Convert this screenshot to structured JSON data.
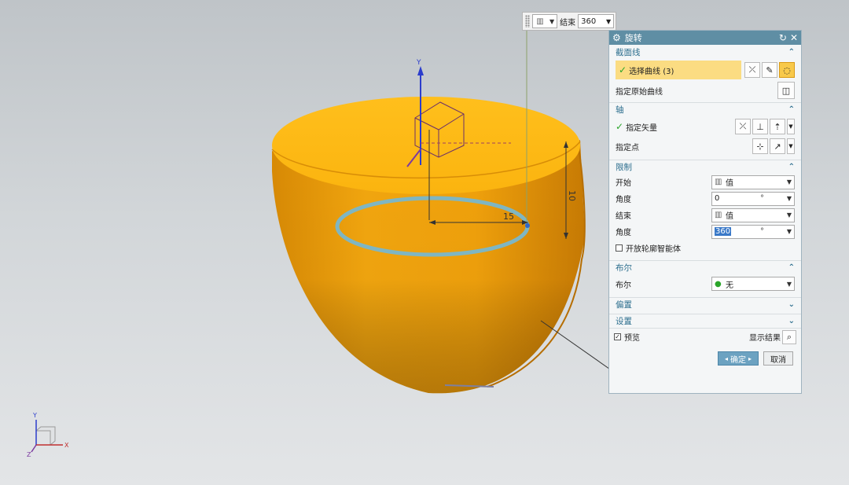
{
  "mini_toolbar": {
    "end_label": "结束",
    "end_value": "360"
  },
  "axes_triad": {
    "x": "X",
    "y": "Y",
    "z": "Z"
  },
  "viewport": {
    "y_label": "Y",
    "dim_15": "15",
    "dim_vertical": "10"
  },
  "dialog": {
    "title": "旋转",
    "sections": {
      "section_curve": "截面线",
      "axis": "轴",
      "limits": "限制",
      "boolean": "布尔",
      "offset": "偏置",
      "settings": "设置"
    },
    "select_curve": "选择曲线 (3)",
    "specify_origin_curve": "指定原始曲线",
    "specify_vector": "指定矢量",
    "specify_point": "指定点",
    "start_label": "开始",
    "start_value": "值",
    "start_angle_label": "角度",
    "start_angle_value": "0",
    "end_label": "结束",
    "end_value": "值",
    "end_angle_label": "角度",
    "end_angle_value": "360",
    "deg_unit": "°",
    "open_profile_label": "开放轮廓智能体",
    "bool_label": "布尔",
    "bool_value": "无",
    "preview_label": "预览",
    "show_result_label": "显示结果",
    "ok_label": "确定",
    "cancel_label": "取消"
  }
}
